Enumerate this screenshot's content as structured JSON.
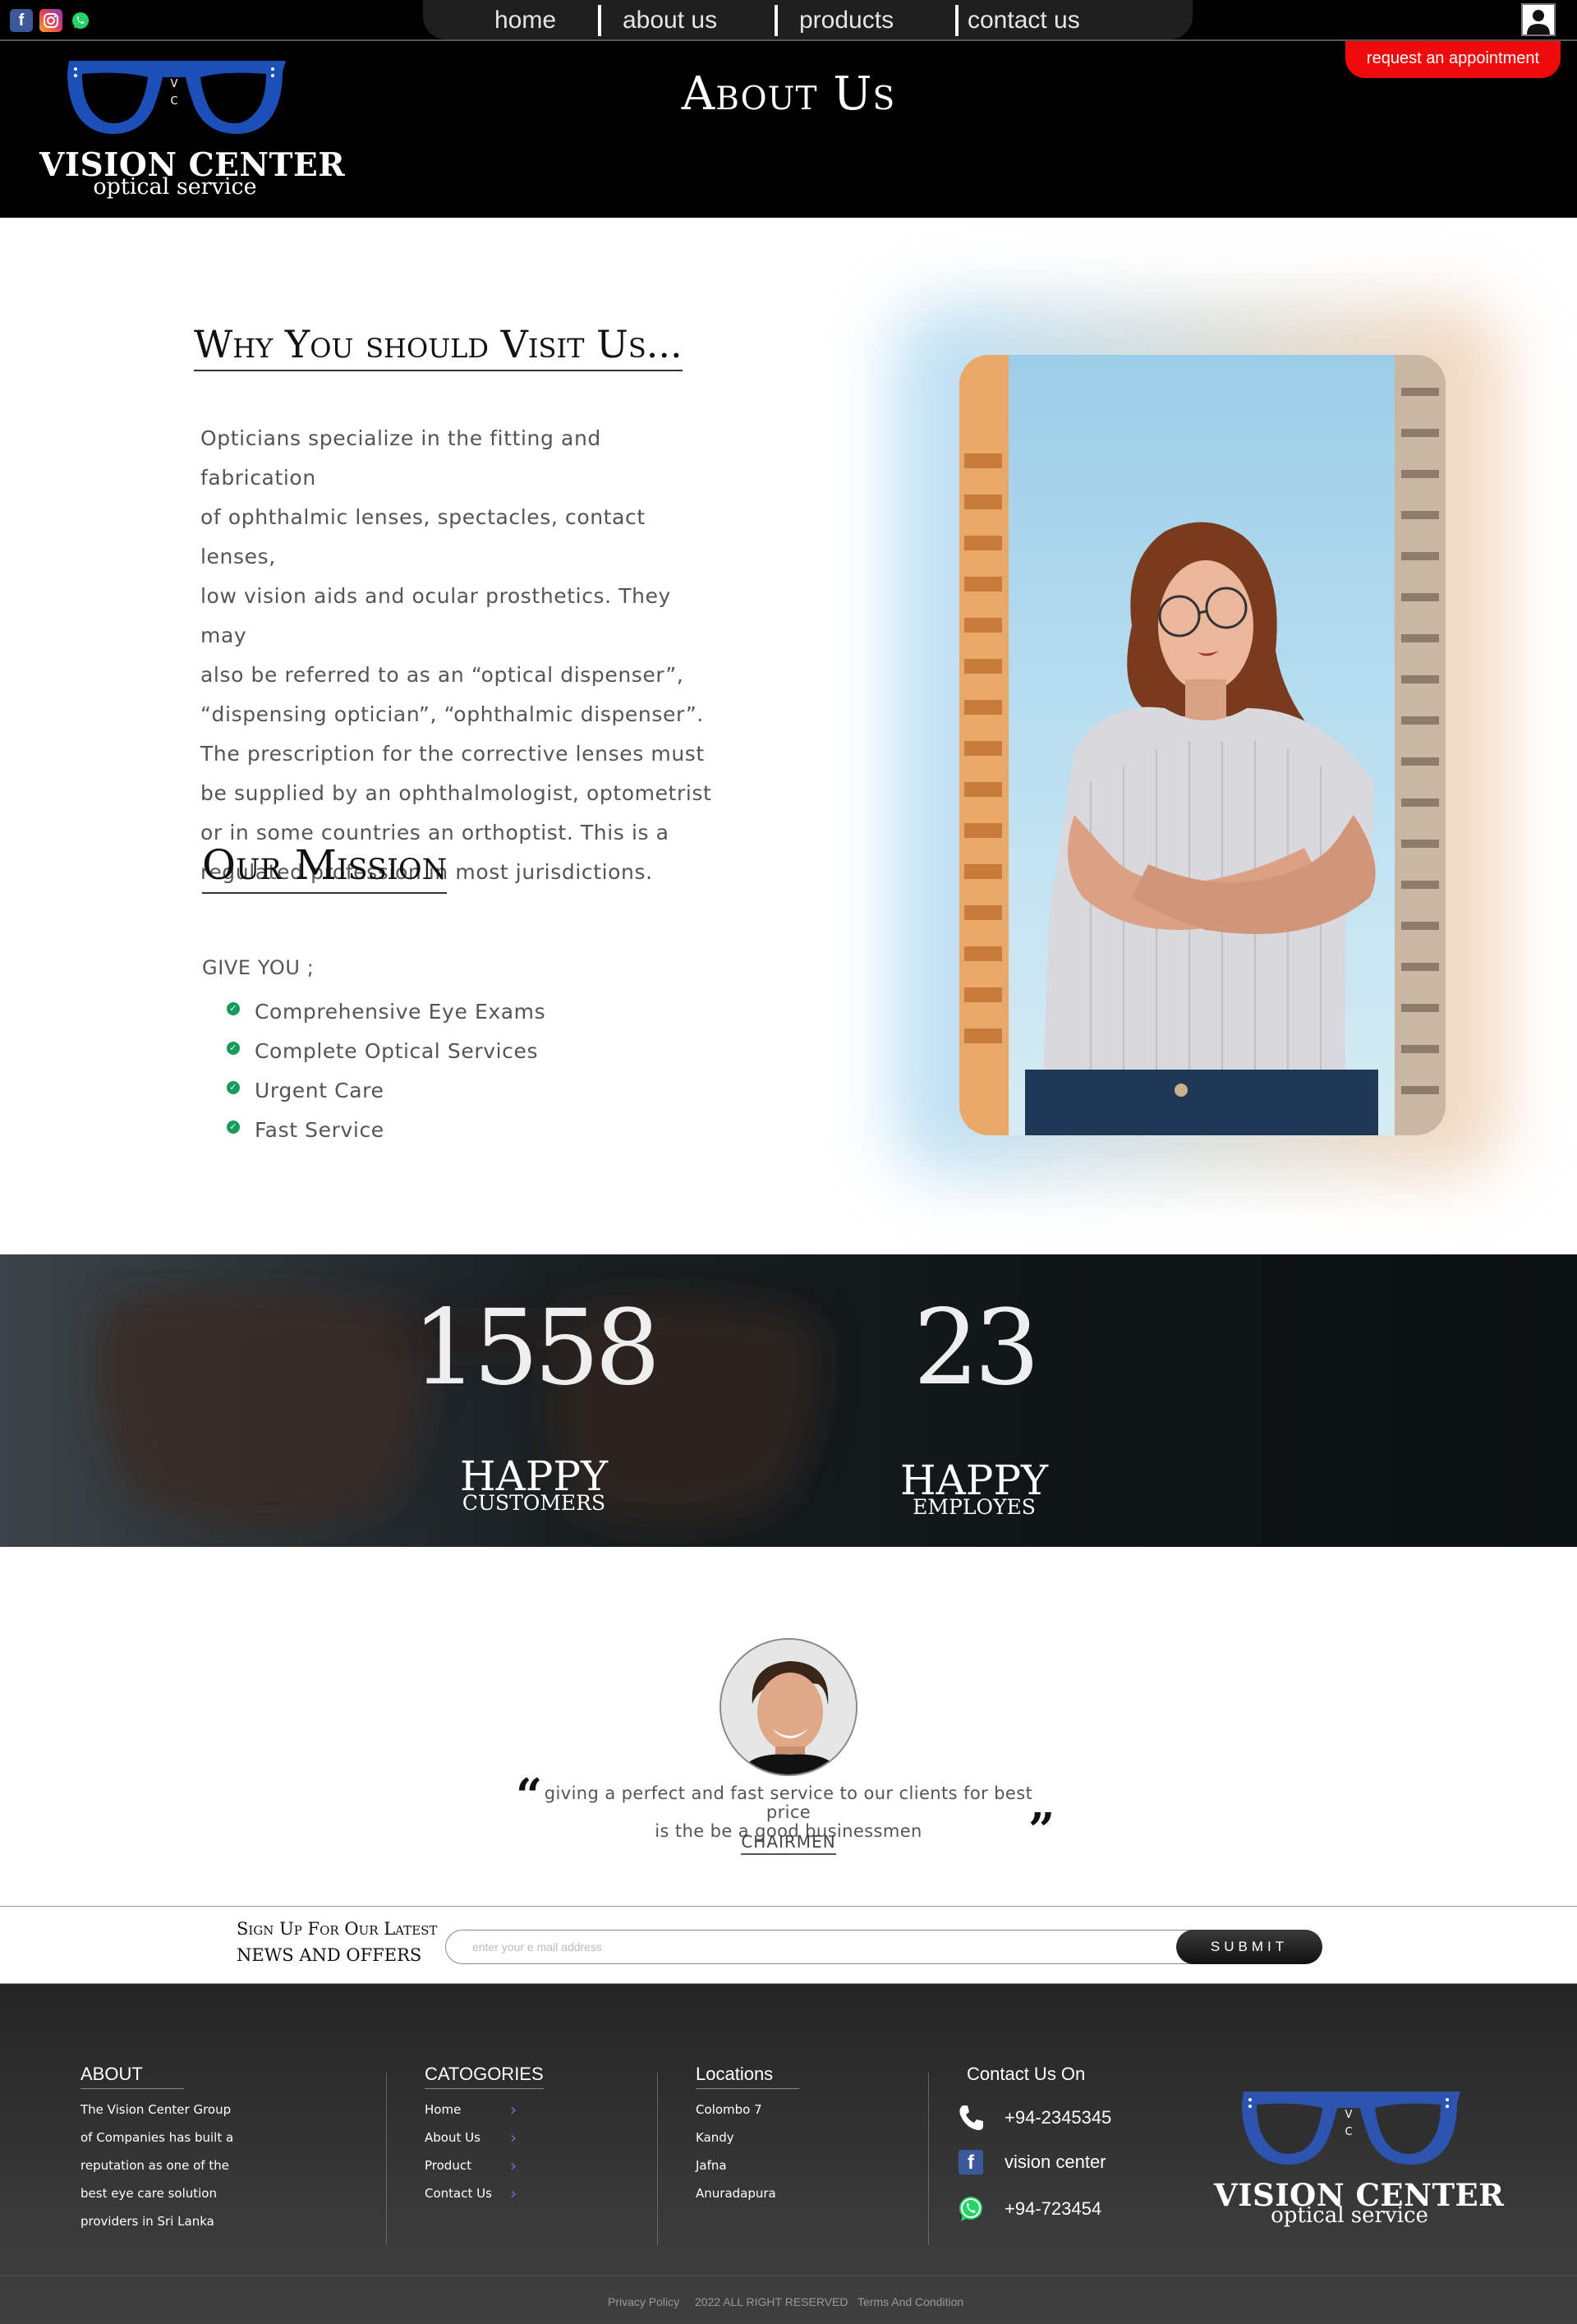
{
  "social": {
    "facebook_icon": "facebook-icon",
    "instagram_icon": "instagram-icon",
    "whatsapp_icon": "whatsapp-icon"
  },
  "nav": {
    "items": [
      "home",
      "about us",
      "products",
      "contact us"
    ]
  },
  "user_icon": "user-icon",
  "header": {
    "logo_monogram_v": "V",
    "logo_monogram_c": "C",
    "logo_name": "VISION CENTER",
    "logo_tagline": "optical service",
    "title": "About Us",
    "appointment_button": "request an appointment"
  },
  "intro": {
    "heading": "Why You should Visit Us...",
    "lines": [
      "Opticians specialize in the fitting and fabrication",
      "of ophthalmic lenses, spectacles, contact lenses,",
      "low vision aids and ocular prosthetics. They may",
      "also be referred to as an “optical dispenser”,",
      "“dispensing optician”, “ophthalmic dispenser”.",
      "The prescription for the corrective lenses must",
      "be supplied by an ophthalmologist, optometrist",
      "or in some countries an orthoptist. This is a",
      "regulated profession in most jurisdictions."
    ]
  },
  "mission": {
    "heading": "Our Mission",
    "give_label": "GIVE YOU ;",
    "items": [
      "Comprehensive Eye Exams",
      "Complete Optical Services",
      "Urgent Care",
      "Fast Service"
    ]
  },
  "stats": {
    "customers_value": "1558",
    "customers_label": "HAPPY",
    "customers_sub": "CUSTOMERS",
    "employees_value": "23",
    "employees_label": "HAPPY",
    "employees_sub": "EMPLOYES"
  },
  "testimonial": {
    "line1": "giving a perfect and fast service to our clients for best price",
    "line2": "is the  be a good businessmen",
    "author": "CHAIRMEN",
    "open_quote": "“",
    "close_quote": "”"
  },
  "newsletter": {
    "label_line1": "Sign Up For Our Latest",
    "label_line2": "NEWS AND OFFERS",
    "placeholder": "enter your e mail address",
    "submit": "SUBMIT"
  },
  "footer": {
    "about_heading": "ABOUT",
    "about_lines": [
      "The Vision Center Group",
      "of Companies has built a",
      "reputation as one of the",
      "best eye care solution",
      "providers in Sri Lanka"
    ],
    "categories_heading": "CATOGORIES",
    "categories": [
      "Home",
      "About Us",
      "Product",
      "Contact Us"
    ],
    "locations_heading": "Locations",
    "locations": [
      "Colombo 7",
      "Kandy",
      "Jafna",
      "Anuradapura"
    ],
    "contact_heading": "Contact Us On",
    "phone": "+94-2345345",
    "facebook": "vision center",
    "whatsapp": "+94-723454",
    "logo_monogram_v": "V",
    "logo_monogram_c": "C",
    "logo_name": "VISION CENTER",
    "logo_tagline": "optical service",
    "bottom_privacy": "Privacy Policy",
    "bottom_rights": "2022 ALL RIGHT RESERVED",
    "bottom_terms": "Terms And Condition"
  },
  "colors": {
    "accent_red": "#ef0b0b",
    "logo_blue": "#1d4fb8",
    "check_green": "#1a9a5a",
    "footer_bg": "#2e2e2e"
  }
}
